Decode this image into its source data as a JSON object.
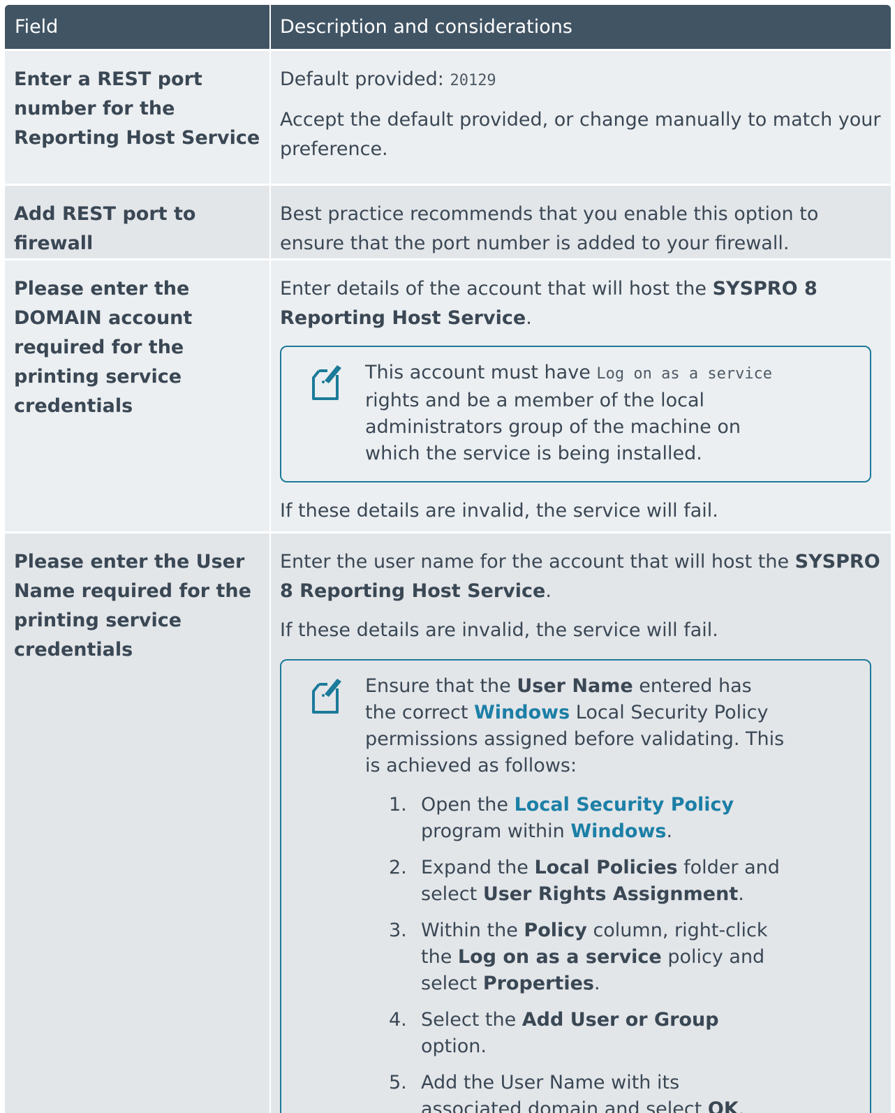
{
  "header": {
    "field": "Field",
    "description": "Description and considerations"
  },
  "rows": [
    {
      "field": "Enter a REST port number for the Reporting Host Service",
      "default_prefix": "Default provided: ",
      "default_value": "20129",
      "text": "Accept the default provided, or change manually to match your preference."
    },
    {
      "field": "Add REST port to firewall",
      "text": "Best practice recommends that you enable this option to ensure that the port number is added to your firewall."
    },
    {
      "field": "Please enter the DOMAIN account required for the printing service credentials",
      "text_before": "Enter details of the account that will host the ",
      "text_bold": "SYSPRO 8 Reporting Host Service",
      "text_after": ".",
      "note": {
        "pre": "This account must have ",
        "code": "Log on as a service",
        "post": " rights and be a member of the local administrators group of the machine on which the service is being installed."
      },
      "footer": "If these details are invalid, the service will fail."
    },
    {
      "field": "Please enter the User Name required for the printing service credentials",
      "text_before": "Enter the user name for the account that will host the ",
      "text_bold": "SYSPRO 8 Reporting Host Service",
      "text_after": ".",
      "text2": "If these details are invalid, the service will fail.",
      "note": {
        "p1": "Ensure that the ",
        "b1": "User Name",
        "p2": " entered has the correct ",
        "l1": "Windows",
        "p3": " Local Security Policy permissions assigned before validating. This is achieved as follows:",
        "steps": [
          {
            "num": "1.",
            "a": "Open the ",
            "link1": "Local Security Policy",
            "b": " program within ",
            "link2": "Windows",
            "c": "."
          },
          {
            "num": "2.",
            "a": "Expand the ",
            "b1": "Local Policies",
            "b": " folder and select ",
            "b2": "User Rights Assignment",
            "c": "."
          },
          {
            "num": "3.",
            "a": "Within the ",
            "b1": "Policy",
            "b": " column, right-click the ",
            "b2": "Log on as a service",
            "c": " policy and select ",
            "b3": "Properties",
            "d": "."
          },
          {
            "num": "4.",
            "a": "Select the ",
            "b1": "Add User or Group",
            "b": " option."
          },
          {
            "num": "5.",
            "a": "Add the User Name with its associated domain and select ",
            "b1": "OK",
            "b": "."
          }
        ]
      }
    }
  ],
  "icon": "note-icon",
  "colors": {
    "header_bg": "#415464",
    "accent": "#1c7a9a",
    "link": "#1c7fa6"
  }
}
